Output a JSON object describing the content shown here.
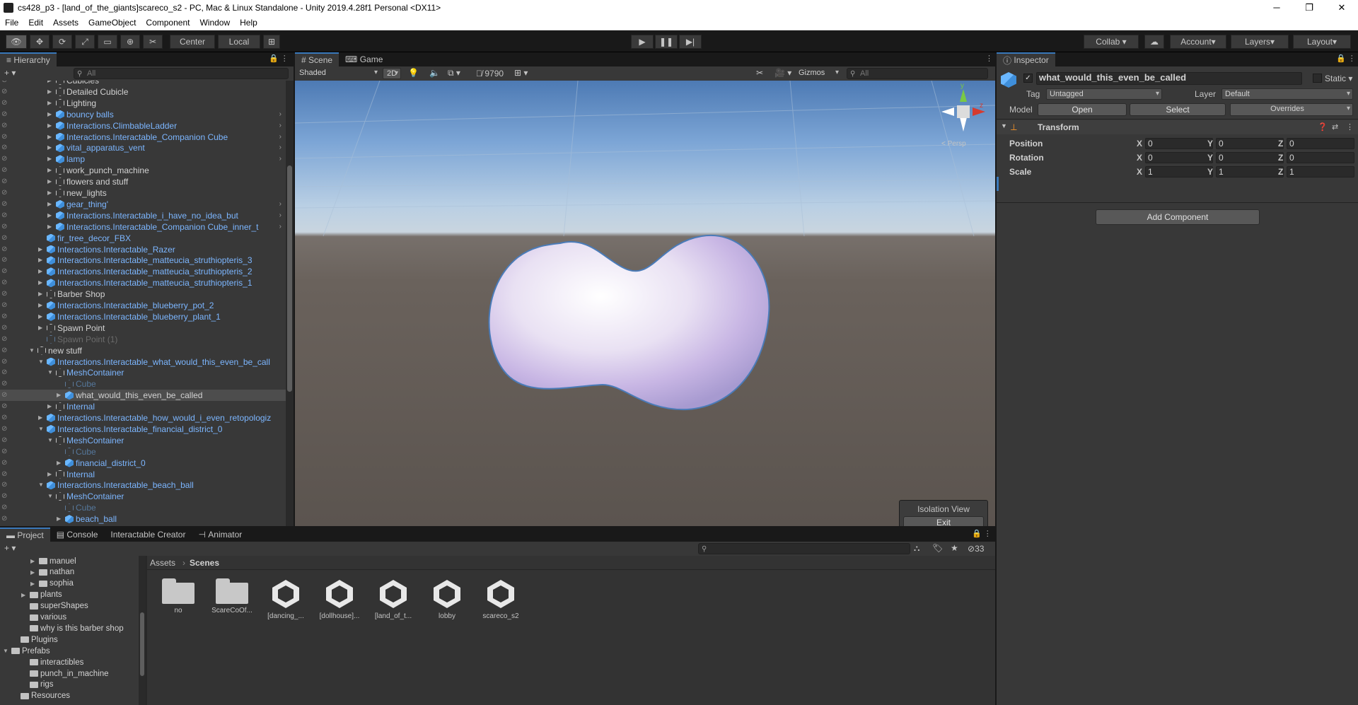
{
  "window": {
    "title": "cs428_p3 - [land_of_the_giants]scareco_s2 - PC, Mac & Linux Standalone - Unity 2019.4.28f1 Personal <DX11>",
    "minimize": "─",
    "maximize": "❐",
    "close": "✕"
  },
  "menu": [
    "File",
    "Edit",
    "Assets",
    "GameObject",
    "Component",
    "Window",
    "Help"
  ],
  "toolbar": {
    "center": "Center",
    "local": "Local",
    "collab": "Collab ▾",
    "account": "Account",
    "layers": "Layers",
    "layout": "Layout"
  },
  "hierarchy": {
    "tab": "Hierarchy",
    "add": "+ ▾",
    "search_placeholder": "All",
    "rows": [
      {
        "label": "Cubicles",
        "depth": 1,
        "color": "w",
        "icon": "gray",
        "arrow": true
      },
      {
        "label": "Detailed Cubicle",
        "depth": 1,
        "color": "w",
        "icon": "gray",
        "arrow": true
      },
      {
        "label": "Lighting",
        "depth": 1,
        "color": "w",
        "icon": "gray",
        "arrow": true
      },
      {
        "label": "bouncy balls",
        "depth": 1,
        "color": "b",
        "icon": "blue",
        "arrow": true,
        "chev": true
      },
      {
        "label": "Interactions.ClimbableLadder",
        "depth": 1,
        "color": "b",
        "icon": "blue",
        "arrow": true,
        "chev": true
      },
      {
        "label": "Interactions.Interactable_Companion Cube",
        "depth": 1,
        "color": "b",
        "icon": "blue",
        "arrow": true,
        "chev": true
      },
      {
        "label": "vital_apparatus_vent",
        "depth": 1,
        "color": "b",
        "icon": "blue",
        "arrow": true,
        "chev": true
      },
      {
        "label": "lamp",
        "depth": 1,
        "color": "b",
        "icon": "blue",
        "arrow": true,
        "chev": true
      },
      {
        "label": "work_punch_machine",
        "depth": 1,
        "color": "w",
        "icon": "gray",
        "arrow": true
      },
      {
        "label": "flowers and stuff",
        "depth": 1,
        "color": "w",
        "icon": "gray",
        "arrow": true
      },
      {
        "label": "new_lights",
        "depth": 1,
        "color": "w",
        "icon": "gray",
        "arrow": true
      },
      {
        "label": "gear_thing'",
        "depth": 1,
        "color": "b",
        "icon": "blue",
        "arrow": true,
        "chev": true
      },
      {
        "label": "Interactions.Interactable_i_have_no_idea_but",
        "depth": 1,
        "color": "b",
        "icon": "blue",
        "arrow": true,
        "chev": true
      },
      {
        "label": "Interactions.Interactable_Companion Cube_inner_t",
        "depth": 1,
        "color": "b",
        "icon": "blue",
        "arrow": true,
        "chev": true
      },
      {
        "label": "fir_tree_decor_FBX",
        "depth": 0,
        "color": "b",
        "icon": "blue",
        "arrow": false
      },
      {
        "label": "Interactions.Interactable_Razer",
        "depth": 0,
        "color": "b",
        "icon": "blue",
        "arrow": true
      },
      {
        "label": "Interactions.Interactable_matteucia_struthiopteris_3",
        "depth": 0,
        "color": "b",
        "icon": "blue",
        "arrow": true
      },
      {
        "label": "Interactions.Interactable_matteucia_struthiopteris_2",
        "depth": 0,
        "color": "b",
        "icon": "blue",
        "arrow": true
      },
      {
        "label": "Interactions.Interactable_matteucia_struthiopteris_1",
        "depth": 0,
        "color": "b",
        "icon": "blue",
        "arrow": true
      },
      {
        "label": "Barber Shop",
        "depth": 0,
        "color": "w",
        "icon": "gray",
        "arrow": true
      },
      {
        "label": "Interactions.Interactable_blueberry_pot_2",
        "depth": 0,
        "color": "b",
        "icon": "blue",
        "arrow": true
      },
      {
        "label": "Interactions.Interactable_blueberry_plant_1",
        "depth": 0,
        "color": "b",
        "icon": "blue",
        "arrow": true
      },
      {
        "label": "Spawn Point",
        "depth": 0,
        "color": "w",
        "icon": "gray",
        "arrow": true
      },
      {
        "label": "Spawn Point (1)",
        "depth": 0,
        "color": "d",
        "icon": "dim",
        "arrow": false
      },
      {
        "label": "new stuff",
        "depth": -1,
        "color": "w",
        "icon": "gray",
        "arrow": true,
        "open": true
      },
      {
        "label": "Interactions.Interactable_what_would_this_even_be_call",
        "depth": 0,
        "color": "b",
        "icon": "blue",
        "arrow": true,
        "open": true
      },
      {
        "label": "MeshContainer",
        "depth": 1,
        "color": "b",
        "icon": "gray",
        "arrow": true,
        "open": true
      },
      {
        "label": "Cube",
        "depth": 2,
        "color": "db",
        "icon": "dim",
        "arrow": false
      },
      {
        "label": "what_would_this_even_be_called",
        "depth": 2,
        "color": "w",
        "icon": "blue",
        "arrow": true,
        "sel": true
      },
      {
        "label": "Internal",
        "depth": 1,
        "color": "b",
        "icon": "gray",
        "arrow": true
      },
      {
        "label": "Interactions.Interactable_how_would_i_even_retopologiz",
        "depth": 0,
        "color": "b",
        "icon": "blue",
        "arrow": true
      },
      {
        "label": "Interactions.Interactable_financial_district_0",
        "depth": 0,
        "color": "b",
        "icon": "blue",
        "arrow": true,
        "open": true
      },
      {
        "label": "MeshContainer",
        "depth": 1,
        "color": "b",
        "icon": "gray",
        "arrow": true,
        "open": true
      },
      {
        "label": "Cube",
        "depth": 2,
        "color": "db",
        "icon": "dim",
        "arrow": false
      },
      {
        "label": "financial_district_0",
        "depth": 2,
        "color": "b",
        "icon": "blue",
        "arrow": true
      },
      {
        "label": "Internal",
        "depth": 1,
        "color": "b",
        "icon": "gray",
        "arrow": true
      },
      {
        "label": "Interactions.Interactable_beach_ball",
        "depth": 0,
        "color": "b",
        "icon": "blue",
        "arrow": true,
        "open": true
      },
      {
        "label": "MeshContainer",
        "depth": 1,
        "color": "b",
        "icon": "gray",
        "arrow": true,
        "open": true
      },
      {
        "label": "Cube",
        "depth": 2,
        "color": "db",
        "icon": "dim",
        "arrow": false
      },
      {
        "label": "beach_ball",
        "depth": 2,
        "color": "b",
        "icon": "blue",
        "arrow": true
      }
    ]
  },
  "scene": {
    "tab_scene": "Scene",
    "tab_game": "Game",
    "shading": "Shaded",
    "mode2d": "2D",
    "hidden_count": "9790",
    "gizmos": "Gizmos",
    "search_placeholder": "All",
    "persp": "< Persp",
    "axis_x": "x",
    "axis_y": "y",
    "axis_z": "z",
    "isolation_title": "Isolation View",
    "isolation_exit": "Exit"
  },
  "inspector": {
    "tab": "Inspector",
    "object_name": "what_would_this_even_be_called",
    "static": "Static",
    "tag_label": "Tag",
    "tag_value": "Untagged",
    "layer_label": "Layer",
    "layer_value": "Default",
    "model_label": "Model",
    "open": "Open",
    "select": "Select",
    "overrides": "Overrides",
    "component": "Transform",
    "add_component": "Add Component",
    "transform": [
      {
        "label": "Position",
        "x": "0",
        "y": "0",
        "z": "0"
      },
      {
        "label": "Rotation",
        "x": "0",
        "y": "0",
        "z": "0"
      },
      {
        "label": "Scale",
        "x": "1",
        "y": "1",
        "z": "1"
      }
    ]
  },
  "bottom": {
    "tabs": [
      "Project",
      "Console",
      "Interactable Creator",
      "Animator"
    ],
    "add": "+ ▾",
    "hidden_count": "33",
    "breadcrumb": [
      "Assets",
      "Scenes"
    ],
    "tree": [
      {
        "label": "manuel",
        "indent": 3,
        "arrow": true
      },
      {
        "label": "nathan",
        "indent": 3,
        "arrow": true
      },
      {
        "label": "sophia",
        "indent": 3,
        "arrow": true
      },
      {
        "label": "plants",
        "indent": 2,
        "arrow": true
      },
      {
        "label": "superShapes",
        "indent": 2,
        "arrow": false
      },
      {
        "label": "various",
        "indent": 2,
        "arrow": false
      },
      {
        "label": "why is this barber shop",
        "indent": 2,
        "arrow": false
      },
      {
        "label": "Plugins",
        "indent": 1,
        "arrow": false
      },
      {
        "label": "Prefabs",
        "indent": 0,
        "arrow": true,
        "open": true
      },
      {
        "label": "interactibles",
        "indent": 2,
        "arrow": false
      },
      {
        "label": "punch_in_machine",
        "indent": 2,
        "arrow": false
      },
      {
        "label": "rigs",
        "indent": 2,
        "arrow": false
      },
      {
        "label": "Resources",
        "indent": 1,
        "arrow": false
      }
    ],
    "assets": [
      {
        "label": "no",
        "kind": "folder"
      },
      {
        "label": "ScareCoOf...",
        "kind": "folder"
      },
      {
        "label": "[dancing_...",
        "kind": "unity"
      },
      {
        "label": "[dollhouse]...",
        "kind": "unity"
      },
      {
        "label": "[land_of_t...",
        "kind": "unity"
      },
      {
        "label": "lobby",
        "kind": "unity"
      },
      {
        "label": "scareco_s2",
        "kind": "unity"
      }
    ]
  }
}
